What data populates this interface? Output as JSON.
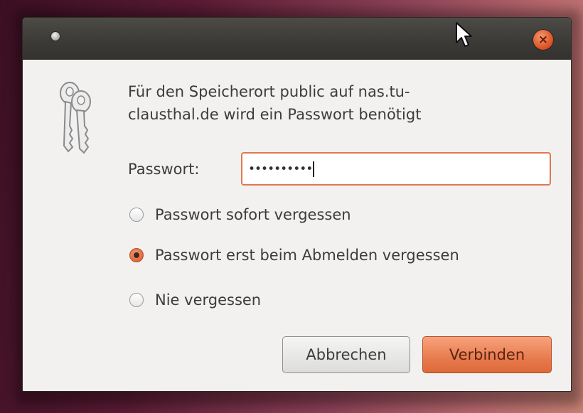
{
  "window": {
    "menu_icon": "window-menu-dot",
    "close_glyph": "×"
  },
  "dialog": {
    "message": "Für den Speicherort public auf nas.tu-clausthal.de wird ein Passwort benötigt",
    "message_line1": "Für den Speicherort public auf nas.tu-",
    "message_line2": "clausthal.de wird ein Passwort benötigt",
    "icon": "keys-icon"
  },
  "password": {
    "label": "Passwort:",
    "masked_value": "••••••••••"
  },
  "remember_options": [
    {
      "label": "Passwort sofort vergessen",
      "checked": false
    },
    {
      "label": "Passwort erst beim Abmelden vergessen",
      "checked": true
    },
    {
      "label": "Nie vergessen",
      "checked": false
    }
  ],
  "buttons": {
    "cancel": "Abbrechen",
    "connect": "Verbinden"
  },
  "colors": {
    "accent": "#e2774f",
    "titlebar": "#3c3b37",
    "dialog_bg": "#f2f1f0"
  }
}
